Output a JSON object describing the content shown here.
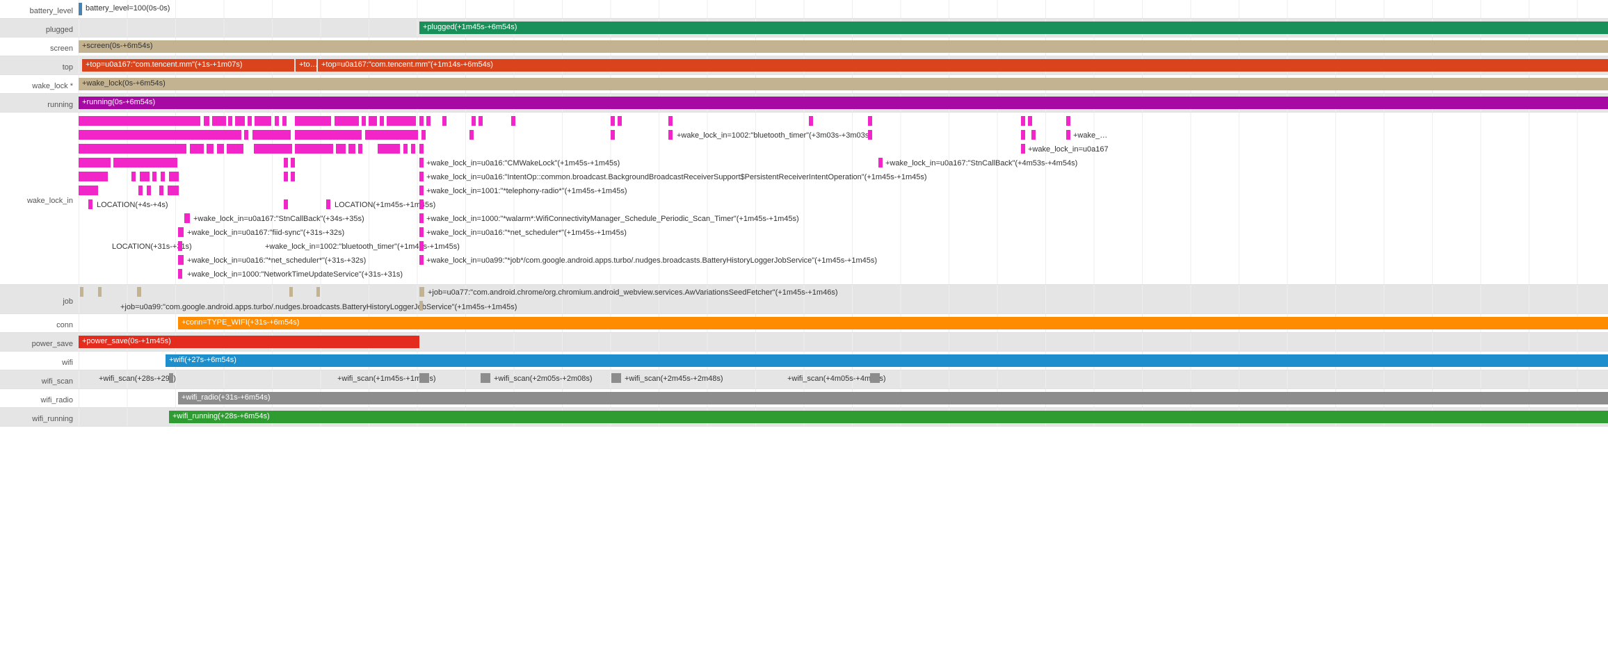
{
  "rows": {
    "battery_level": {
      "label": "battery_level",
      "text": "battery_level=100(0s-0s)"
    },
    "plugged": {
      "label": "plugged",
      "text": "+plugged(+1m45s-+6m54s)"
    },
    "screen": {
      "label": "screen",
      "text": "+screen(0s-+6m54s)"
    },
    "top": {
      "label": "top",
      "b1": "+top=u0a167:\"com.tencent.mm\"(+1s-+1m07s)",
      "b2": "+to…",
      "b3": "+top=u0a167:\"com.tencent.mm\"(+1m14s-+6m54s)"
    },
    "wake_lock": {
      "label": "wake_lock *",
      "text": "+wake_lock(0s-+6m54s)"
    },
    "running": {
      "label": "running",
      "text": "+running(0s-+6m54s)"
    },
    "wake_lock_in": {
      "label": "wake_lock_in"
    },
    "job": {
      "label": "job",
      "t1": "+job=u0a99:\"com.google.android.apps.turbo/.nudges.broadcasts.BatteryHistoryLoggerJobService\"(+1m45s-+1m45s)",
      "t2": "+job=u0a77:\"com.android.chrome/org.chromium.android_webview.services.AwVariationsSeedFetcher\"(+1m45s-+1m46s)"
    },
    "conn": {
      "label": "conn",
      "text": "+conn=TYPE_WIFI(+31s-+6m54s)"
    },
    "power_save": {
      "label": "power_save",
      "text": "+power_save(0s-+1m45s)"
    },
    "wifi": {
      "label": "wifi",
      "text": "+wifi(+27s-+6m54s)"
    },
    "wifi_scan": {
      "label": "wifi_scan",
      "s1": "+wifi_scan(+28s-+29s)",
      "s2": "+wifi_scan(+1m45s-+1m48s)",
      "s3": "+wifi_scan(+2m05s-+2m08s)",
      "s4": "+wifi_scan(+2m45s-+2m48s)",
      "s5": "+wifi_scan(+4m05s-+4m08s)"
    },
    "wifi_radio": {
      "label": "wifi_radio",
      "text": "+wifi_radio(+31s-+6m54s)"
    },
    "wifi_running": {
      "label": "wifi_running",
      "text": "+wifi_running(+28s-+6m54s)"
    }
  },
  "wake_lock_in_labels": {
    "loc1": "LOCATION(+4s-+4s)",
    "loc2": "LOCATION(+31s-+31s)",
    "loc3": "LOCATION(+1m45s-+1m45s)",
    "l1": "+wake_lock_in=u0a167:\"StnCallBack\"(+34s-+35s)",
    "l2": "+wake_lock_in=u0a167:\"fiid-sync\"(+31s-+32s)",
    "l3": "+wake_lock_in=u0a16:\"*net_scheduler*\"(+31s-+32s)",
    "l4": "+wake_lock_in=1000:\"NetworkTimeUpdateService\"(+31s-+31s)",
    "l5": "+wake_lock_in=1002:\"bluetooth_timer\"(+1m45s-+1m45s)",
    "l6": "+wake_lock_in=u0a16:\"CMWakeLock\"(+1m45s-+1m45s)",
    "l7": "+wake_lock_in=u0a16:\"IntentOp::common.broadcast.BackgroundBroadcastReceiverSupport$PersistentReceiverIntentOperation\"(+1m45s-+1m45s)",
    "l8": "+wake_lock_in=1001:\"*telephony-radio*\"(+1m45s-+1m45s)",
    "l9": "+wake_lock_in=1000:\"*walarm*:WifiConnectivityManager_Schedule_Periodic_Scan_Timer\"(+1m45s-+1m45s)",
    "l10": "+wake_lock_in=u0a16:\"*net_scheduler*\"(+1m45s-+1m45s)",
    "l11": "+wake_lock_in=u0a99:\"*job*/com.google.android.apps.turbo/.nudges.broadcasts.BatteryHistoryLoggerJobService\"(+1m45s-+1m45s)",
    "l12": "+wake_lock_in=1002:\"bluetooth_timer\"(+3m03s-+3m03s)",
    "l13": "+wake_lock_in=u0a167:\"StnCallBack\"(+4m53s-+4m54s)",
    "l14": "+wake_lock_in=u0a167",
    "l15": "+wake_…"
  },
  "chart_data": {
    "type": "gantt",
    "time_axis": {
      "unit": "seconds",
      "start": 0,
      "end": 414,
      "grid_interval_s": 20
    },
    "tracks": [
      {
        "name": "battery_level",
        "events": [
          {
            "label": "battery_level=100",
            "start": 0,
            "end": 0
          }
        ]
      },
      {
        "name": "plugged",
        "events": [
          {
            "start": 105,
            "end": 414
          }
        ]
      },
      {
        "name": "screen",
        "events": [
          {
            "start": 0,
            "end": 414
          }
        ]
      },
      {
        "name": "top",
        "events": [
          {
            "label": "u0a167:com.tencent.mm",
            "start": 1,
            "end": 67
          },
          {
            "label": "…",
            "start": 67,
            "end": 74
          },
          {
            "label": "u0a167:com.tencent.mm",
            "start": 74,
            "end": 414
          }
        ]
      },
      {
        "name": "wake_lock",
        "events": [
          {
            "start": 0,
            "end": 414
          }
        ]
      },
      {
        "name": "running",
        "events": [
          {
            "start": 0,
            "end": 414
          }
        ]
      },
      {
        "name": "wake_lock_in",
        "events": [
          {
            "label": "LOCATION",
            "start": 4,
            "end": 4
          },
          {
            "label": "LOCATION",
            "start": 31,
            "end": 31
          },
          {
            "label": "u0a167:StnCallBack",
            "start": 34,
            "end": 35
          },
          {
            "label": "u0a167:fiid-sync",
            "start": 31,
            "end": 32
          },
          {
            "label": "u0a16:*net_scheduler*",
            "start": 31,
            "end": 32
          },
          {
            "label": "1000:NetworkTimeUpdateService",
            "start": 31,
            "end": 31
          },
          {
            "label": "1002:bluetooth_timer",
            "start": 105,
            "end": 105
          },
          {
            "label": "LOCATION",
            "start": 105,
            "end": 105
          },
          {
            "label": "u0a16:CMWakeLock",
            "start": 105,
            "end": 105
          },
          {
            "label": "u0a16:IntentOp…PersistentReceiverIntentOperation",
            "start": 105,
            "end": 105
          },
          {
            "label": "1001:*telephony-radio*",
            "start": 105,
            "end": 105
          },
          {
            "label": "1000:*walarm*:WifiConnectivityManager_Schedule_Periodic_Scan_Timer",
            "start": 105,
            "end": 105
          },
          {
            "label": "u0a16:*net_scheduler*",
            "start": 105,
            "end": 105
          },
          {
            "label": "u0a99:*job*/…BatteryHistoryLoggerJobService",
            "start": 105,
            "end": 105
          },
          {
            "label": "1002:bluetooth_timer",
            "start": 183,
            "end": 183
          },
          {
            "label": "u0a167:StnCallBack",
            "start": 293,
            "end": 294
          },
          {
            "label": "u0a167",
            "start": 414,
            "end": 414
          }
        ]
      },
      {
        "name": "job",
        "events": [
          {
            "label": "u0a99:…BatteryHistoryLoggerJobService",
            "start": 105,
            "end": 105
          },
          {
            "label": "u0a77:…AwVariationsSeedFetcher",
            "start": 105,
            "end": 106
          }
        ]
      },
      {
        "name": "conn",
        "events": [
          {
            "label": "TYPE_WIFI",
            "start": 31,
            "end": 414
          }
        ]
      },
      {
        "name": "power_save",
        "events": [
          {
            "start": 0,
            "end": 105
          }
        ]
      },
      {
        "name": "wifi",
        "events": [
          {
            "start": 27,
            "end": 414
          }
        ]
      },
      {
        "name": "wifi_scan",
        "events": [
          {
            "start": 28,
            "end": 29
          },
          {
            "start": 105,
            "end": 108
          },
          {
            "start": 125,
            "end": 128
          },
          {
            "start": 165,
            "end": 168
          },
          {
            "start": 245,
            "end": 248
          }
        ]
      },
      {
        "name": "wifi_radio",
        "events": [
          {
            "start": 31,
            "end": 414
          }
        ]
      },
      {
        "name": "wifi_running",
        "events": [
          {
            "start": 28,
            "end": 414
          }
        ]
      }
    ]
  }
}
